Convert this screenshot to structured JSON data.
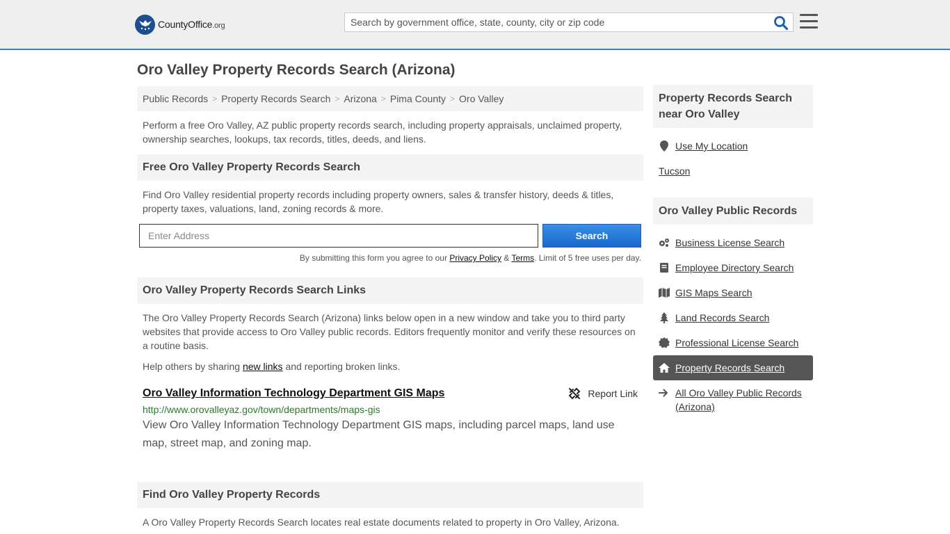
{
  "header": {
    "logo_text": "CountyOffice",
    "logo_tld": ".org",
    "search_placeholder": "Search by government office, state, county, city or zip code"
  },
  "page_title": "Oro Valley Property Records Search (Arizona)",
  "breadcrumb": [
    "Public Records",
    "Property Records Search",
    "Arizona",
    "Pima County",
    "Oro Valley"
  ],
  "intro": "Perform a free Oro Valley, AZ public property records search, including property appraisals, unclaimed property, ownership searches, lookups, tax records, titles, deeds, and liens.",
  "free_search": {
    "heading": "Free Oro Valley Property Records Search",
    "text": "Find Oro Valley residential property records including property owners, sales & transfer history, deeds & titles, property taxes, valuations, land, zoning records & more.",
    "address_placeholder": "Enter Address",
    "button": "Search",
    "disclaimer_pre": "By submitting this form you agree to our ",
    "privacy": "Privacy Policy",
    "amp": " & ",
    "terms": "Terms",
    "disclaimer_post": ". Limit of 5 free uses per day."
  },
  "links_section": {
    "heading": "Oro Valley Property Records Search Links",
    "text": "The Oro Valley Property Records Search (Arizona) links below open in a new window and take you to third party websites that provide access to Oro Valley public records. Editors frequently monitor and verify these resources on a routine basis.",
    "share_pre": "Help others by sharing ",
    "share_link": "new links",
    "share_post": " and reporting broken links.",
    "items": [
      {
        "title": "Oro Valley Information Technology Department GIS Maps",
        "report": "Report Link",
        "url": "http://www.orovalleyaz.gov/town/departments/maps-gis",
        "description": "View Oro Valley Information Technology Department GIS maps, including parcel maps, land use map, street map, and zoning map."
      }
    ]
  },
  "find_section": {
    "heading": "Find Oro Valley Property Records",
    "text": "A Oro Valley Property Records Search locates real estate documents related to property in Oro Valley, Arizona."
  },
  "sidebar": {
    "near_heading": "Property Records Search near Oro Valley",
    "use_location": "Use My Location",
    "nearby": [
      "Tucson"
    ],
    "public_heading": "Oro Valley Public Records",
    "items": [
      {
        "label": "Business License Search",
        "icon": "gears-icon"
      },
      {
        "label": "Employee Directory Search",
        "icon": "book-icon"
      },
      {
        "label": "GIS Maps Search",
        "icon": "map-icon"
      },
      {
        "label": "Land Records Search",
        "icon": "tree-icon"
      },
      {
        "label": "Professional License Search",
        "icon": "certificate-icon"
      },
      {
        "label": "Property Records Search",
        "icon": "home-icon"
      }
    ],
    "all_records": "All Oro Valley Public Records (Arizona)"
  },
  "colors": {
    "accent": "#3e7cc4",
    "button": "#1769cc",
    "active": "#555555",
    "url_green": "#2a7a2a"
  }
}
